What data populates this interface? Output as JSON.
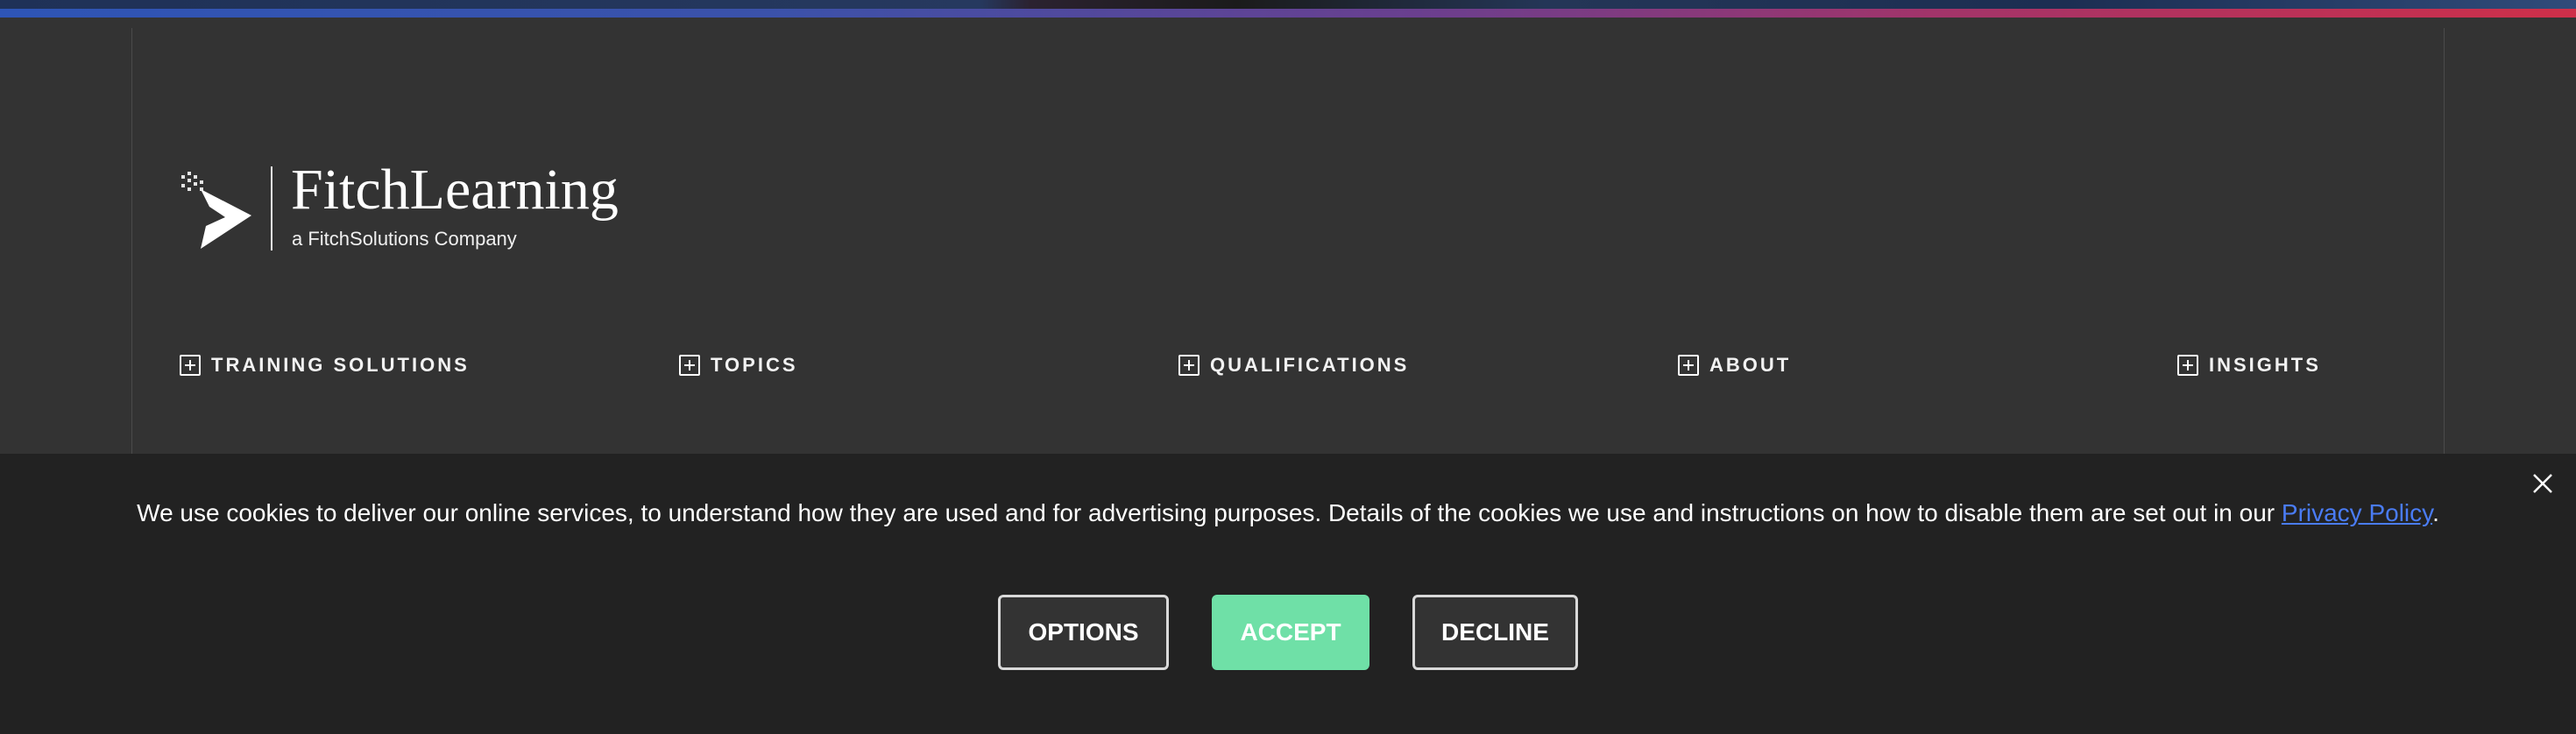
{
  "footer": {
    "logo": {
      "wordmark": "FitchLearning",
      "tagline": "a FitchSolutions Company"
    },
    "nav": [
      {
        "label": "TRAINING SOLUTIONS",
        "icon": "plus-square-icon"
      },
      {
        "label": "TOPICS",
        "icon": "plus-square-icon"
      },
      {
        "label": "QUALIFICATIONS",
        "icon": "plus-square-icon"
      },
      {
        "label": "ABOUT",
        "icon": "plus-square-icon"
      },
      {
        "label": "INSIGHTS",
        "icon": "plus-square-icon"
      }
    ]
  },
  "cookie_banner": {
    "message": "We use cookies to deliver our online services, to understand how they are used and for advertising purposes. Details of the cookies we use and instructions on how to disable them are set out in our ",
    "link_text": "Privacy Policy",
    "message_end": ".",
    "buttons": {
      "options": "OPTIONS",
      "accept": "ACCEPT",
      "decline": "DECLINE"
    },
    "close_icon": "close-icon"
  },
  "colors": {
    "footer_bg": "#333333",
    "banner_bg": "#222222",
    "accept_bg": "#6fe0a7",
    "link": "#4a7cf5"
  }
}
